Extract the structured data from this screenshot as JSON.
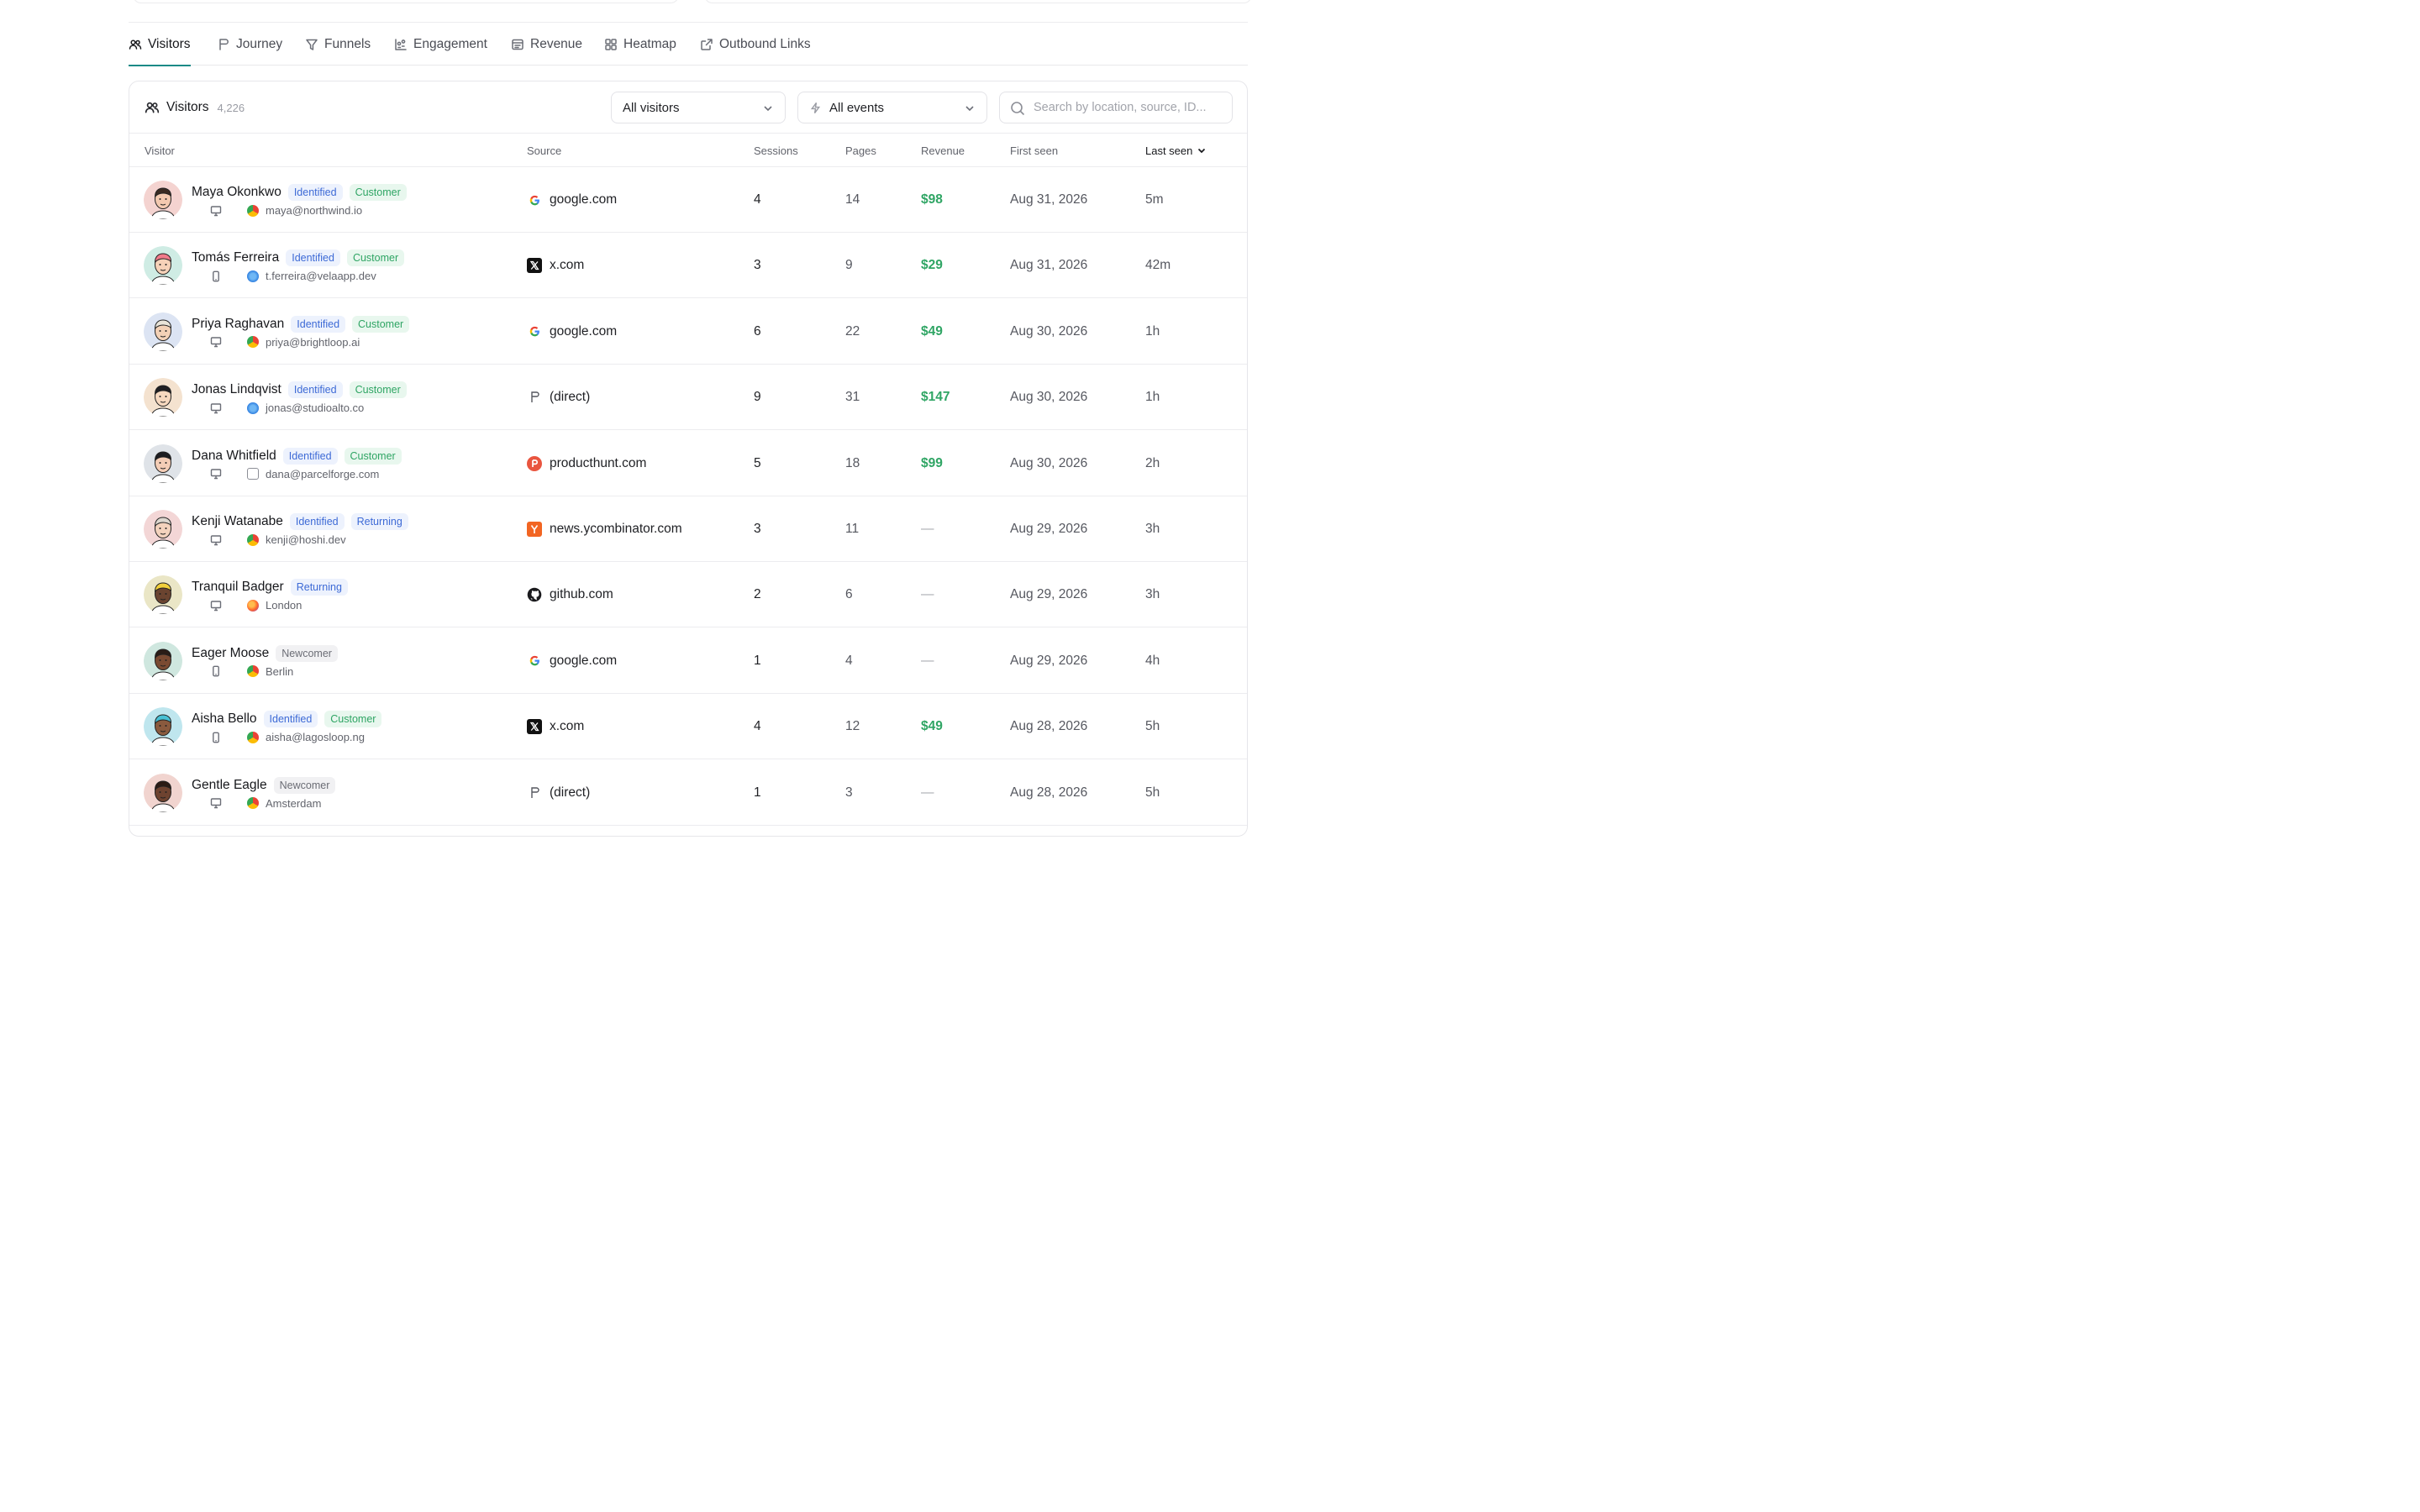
{
  "tabs": [
    {
      "label": "Visitors",
      "icon": "users-icon",
      "active": true
    },
    {
      "label": "Journey",
      "icon": "journey-icon",
      "active": false
    },
    {
      "label": "Funnels",
      "icon": "funnel-icon",
      "active": false
    },
    {
      "label": "Engagement",
      "icon": "engagement-icon",
      "active": false
    },
    {
      "label": "Revenue",
      "icon": "revenue-icon",
      "active": false
    },
    {
      "label": "Heatmap",
      "icon": "heatmap-icon",
      "active": false
    },
    {
      "label": "Outbound Links",
      "icon": "external-link-icon",
      "active": false
    }
  ],
  "panel": {
    "title": "Visitors",
    "count": "4,226",
    "visitors_filter": "All visitors",
    "events_filter": "All events",
    "search_placeholder": "Search by location, source, ID..."
  },
  "columns": {
    "visitor": "Visitor",
    "source": "Source",
    "sessions": "Sessions",
    "pages": "Pages",
    "revenue": "Revenue",
    "first_seen": "First seen",
    "last_seen": "Last seen"
  },
  "colors": {
    "accent": "#1b8a86",
    "revenue_green": "#2fa564",
    "identified_blue": "#3d6ad6"
  },
  "rows": [
    {
      "name": "Maya Okonkwo",
      "badges": [
        "Identified",
        "Customer"
      ],
      "device": "desktop-icon",
      "browser": "chrome",
      "detail": "maya@northwind.io",
      "source": "google.com",
      "source_icon": "google",
      "sessions": "4",
      "pages": "14",
      "revenue": "$98",
      "first_seen": "Aug 31, 2026",
      "last_seen": "5m",
      "avatar": {
        "bg": "#f4d3d0",
        "skin": "#f3c9b0",
        "hair": "#3a2a22"
      }
    },
    {
      "name": "Tomás Ferreira",
      "badges": [
        "Identified",
        "Customer"
      ],
      "device": "mobile-icon",
      "browser": "safari",
      "detail": "t.ferreira@velaapp.dev",
      "source": "x.com",
      "source_icon": "x",
      "sessions": "3",
      "pages": "9",
      "revenue": "$29",
      "first_seen": "Aug 31, 2026",
      "last_seen": "42m",
      "avatar": {
        "bg": "#cfece4",
        "skin": "#f6d1b8",
        "hair": "#f07a8a"
      }
    },
    {
      "name": "Priya Raghavan",
      "badges": [
        "Identified",
        "Customer"
      ],
      "device": "desktop-icon",
      "browser": "chrome",
      "detail": "priya@brightloop.ai",
      "source": "google.com",
      "source_icon": "google",
      "sessions": "6",
      "pages": "22",
      "revenue": "$49",
      "first_seen": "Aug 30, 2026",
      "last_seen": "1h",
      "avatar": {
        "bg": "#dce4f3",
        "skin": "#f3d1b6",
        "hair": "#e9e4d8"
      }
    },
    {
      "name": "Jonas Lindqvist",
      "badges": [
        "Identified",
        "Customer"
      ],
      "device": "desktop-icon",
      "browser": "safari",
      "detail": "jonas@studioalto.co",
      "source": "(direct)",
      "source_icon": "direct",
      "sessions": "9",
      "pages": "31",
      "revenue": "$147",
      "first_seen": "Aug 30, 2026",
      "last_seen": "1h",
      "avatar": {
        "bg": "#f4e2cf",
        "skin": "#f6d8bf",
        "hair": "#1f1f23"
      }
    },
    {
      "name": "Dana Whitfield",
      "badges": [
        "Identified",
        "Customer"
      ],
      "device": "desktop-icon",
      "browser": "plain",
      "detail": "dana@parcelforge.com",
      "source": "producthunt.com",
      "source_icon": "producthunt",
      "sessions": "5",
      "pages": "18",
      "revenue": "$99",
      "first_seen": "Aug 30, 2026",
      "last_seen": "2h",
      "avatar": {
        "bg": "#dfe3e8",
        "skin": "#f4cdb6",
        "hair": "#1c1c20"
      }
    },
    {
      "name": "Kenji Watanabe",
      "badges": [
        "Identified",
        "Returning"
      ],
      "device": "desktop-icon",
      "browser": "chrome",
      "detail": "kenji@hoshi.dev",
      "source": "news.ycombinator.com",
      "source_icon": "ycombinator",
      "sessions": "3",
      "pages": "11",
      "revenue": "—",
      "first_seen": "Aug 29, 2026",
      "last_seen": "3h",
      "avatar": {
        "bg": "#f3d6d6",
        "skin": "#f3d2bd",
        "hair": "#ddd7cf"
      }
    },
    {
      "name": "Tranquil Badger",
      "badges": [
        "Returning"
      ],
      "device": "desktop-icon",
      "browser": "firefox",
      "detail": "London",
      "source": "github.com",
      "source_icon": "github",
      "sessions": "2",
      "pages": "6",
      "revenue": "—",
      "first_seen": "Aug 29, 2026",
      "last_seen": "3h",
      "avatar": {
        "bg": "#eae6c6",
        "skin": "#6b4430",
        "hair": "#f1cf3b"
      }
    },
    {
      "name": "Eager Moose",
      "badges": [
        "Newcomer"
      ],
      "device": "mobile-icon",
      "browser": "chrome",
      "detail": "Berlin",
      "source": "google.com",
      "source_icon": "google",
      "sessions": "1",
      "pages": "4",
      "revenue": "—",
      "first_seen": "Aug 29, 2026",
      "last_seen": "4h",
      "avatar": {
        "bg": "#cfe7df",
        "skin": "#7a4a32",
        "hair": "#2a1c16"
      }
    },
    {
      "name": "Aisha Bello",
      "badges": [
        "Identified",
        "Customer"
      ],
      "device": "mobile-icon",
      "browser": "chrome",
      "detail": "aisha@lagosloop.ng",
      "source": "x.com",
      "source_icon": "x",
      "sessions": "4",
      "pages": "12",
      "revenue": "$49",
      "first_seen": "Aug 28, 2026",
      "last_seen": "5h",
      "avatar": {
        "bg": "#bfe6ee",
        "skin": "#8a5a3e",
        "hair": "#48c0d4"
      }
    },
    {
      "name": "Gentle Eagle",
      "badges": [
        "Newcomer"
      ],
      "device": "desktop-icon",
      "browser": "chrome",
      "detail": "Amsterdam",
      "source": "(direct)",
      "source_icon": "direct",
      "sessions": "1",
      "pages": "3",
      "revenue": "—",
      "first_seen": "Aug 28, 2026",
      "last_seen": "5h",
      "avatar": {
        "bg": "#f1d4cf",
        "skin": "#6e4330",
        "hair": "#2b1b14"
      }
    }
  ]
}
